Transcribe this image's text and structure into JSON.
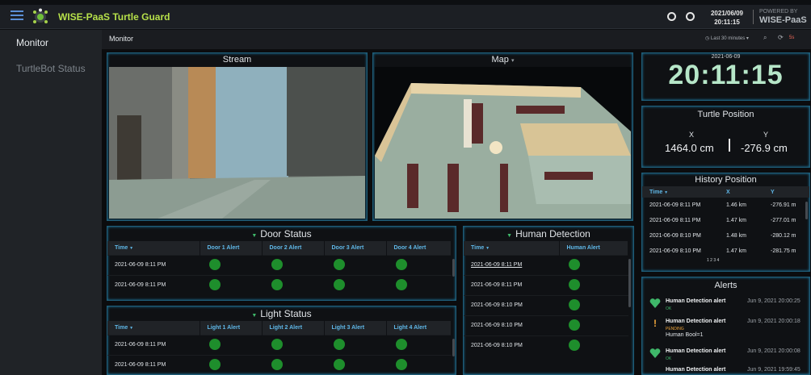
{
  "app": {
    "title": "WISE-PaaS Turtle Guard",
    "date": "2021/06/09",
    "time": "20:11:15",
    "powered_small": "POWERED BY",
    "powered_brand": "WISE-PaaS",
    "accent": "#b6e04a"
  },
  "sidebar": {
    "items": [
      {
        "label": "Monitor"
      },
      {
        "label": "TurtleBot Status"
      }
    ]
  },
  "breadcrumb": {
    "page": "Monitor",
    "time_range": "Last 30 minutes",
    "tools": "5s"
  },
  "stream": {
    "title": "Stream"
  },
  "map": {
    "title": "Map"
  },
  "clock": {
    "date": "2021-06-09",
    "time": "20:11:15"
  },
  "turtle_position": {
    "title": "Turtle Position",
    "x_label": "X",
    "y_label": "Y",
    "x_value": "1464.0 cm",
    "y_value": "-276.9 cm"
  },
  "history": {
    "title": "History Position",
    "columns": [
      "Time",
      "X",
      "Y"
    ],
    "rows": [
      [
        "2021-06-09 8:11 PM",
        "1.46 km",
        "-276.91 m"
      ],
      [
        "2021-06-09 8:11 PM",
        "1.47 km",
        "-277.01 m"
      ],
      [
        "2021-06-09 8:10 PM",
        "1.48 km",
        "-280.12 m"
      ],
      [
        "2021-06-09 8:10 PM",
        "1.47 km",
        "-281.75 m"
      ]
    ],
    "pages": "1 2 3 4"
  },
  "door": {
    "title": "Door Status",
    "columns": [
      "Time",
      "Door 1 Alert",
      "Door 2 Alert",
      "Door 3 Alert",
      "Door 4 Alert"
    ],
    "rows": [
      [
        "2021-06-09 8:11 PM"
      ],
      [
        "2021-06-09 8:11 PM"
      ]
    ]
  },
  "light": {
    "title": "Light Status",
    "columns": [
      "Time",
      "Light 1 Alert",
      "Light 2 Alert",
      "Light 3 Alert",
      "Light 4 Alert"
    ],
    "rows": [
      [
        "2021-06-09 8:11 PM"
      ],
      [
        "2021-06-09 8:11 PM"
      ]
    ]
  },
  "human": {
    "title": "Human Detection",
    "columns": [
      "Time",
      "Human Alert"
    ],
    "rows": [
      [
        "2021-06-09 8:11 PM"
      ],
      [
        "2021-06-09 8:11 PM"
      ],
      [
        "2021-06-09 8:10 PM"
      ],
      [
        "2021-06-09 8:10 PM"
      ],
      [
        "2021-06-09 8:10 PM"
      ]
    ]
  },
  "alerts": {
    "title": "Alerts",
    "items": [
      {
        "name": "Human Detection alert",
        "time": "Jun 9, 2021 20:00:25",
        "status": "OK",
        "extra": "",
        "status_color": "#3fb86a"
      },
      {
        "name": "Human Detection alert",
        "time": "Jun 9, 2021 20:00:18",
        "status": "PENDING",
        "extra": "Human Bool=1",
        "status_color": "#f0a63c"
      },
      {
        "name": "Human Detection alert",
        "time": "Jun 9, 2021 20:00:08",
        "status": "OK",
        "extra": "",
        "status_color": "#3fb86a"
      },
      {
        "name": "Human Detection alert",
        "time": "Jun 9, 2021 19:59:45",
        "status": "",
        "extra": "",
        "status_color": "#3fb86a"
      }
    ]
  },
  "status_colors": {
    "ok": "#1e8e2c",
    "pending": "#f0a63c"
  }
}
